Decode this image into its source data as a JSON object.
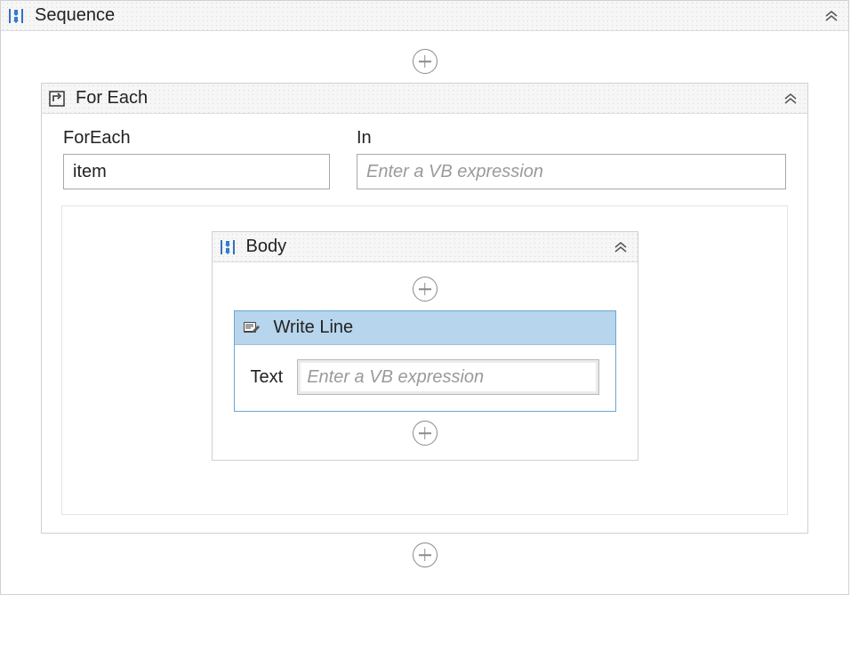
{
  "sequence": {
    "title": "Sequence"
  },
  "foreach": {
    "title": "For Each",
    "iterator_label": "ForEach",
    "iterator_value": "item",
    "collection_label": "In",
    "collection_placeholder": "Enter a VB expression"
  },
  "body": {
    "title": "Body"
  },
  "writeline": {
    "title": "Write Line",
    "text_label": "Text",
    "text_placeholder": "Enter a VB expression"
  }
}
